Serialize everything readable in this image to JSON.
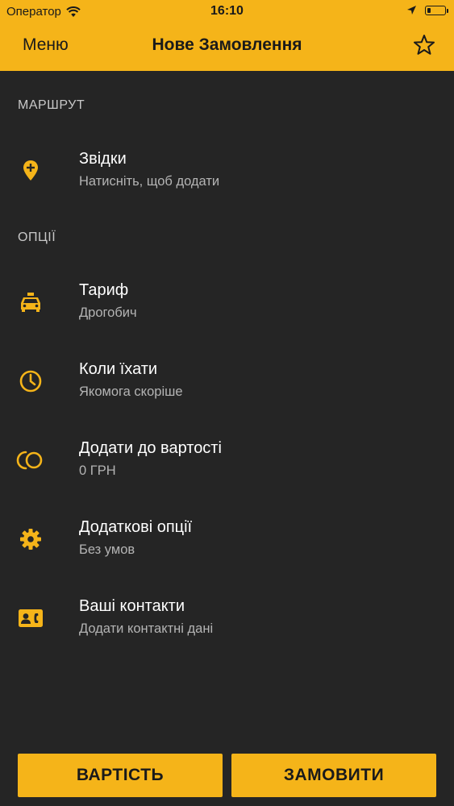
{
  "status_bar": {
    "carrier": "Оператор",
    "time": "16:10",
    "icons": [
      "wifi-icon",
      "location-arrow-icon",
      "battery-icon"
    ]
  },
  "navbar": {
    "menu_label": "Меню",
    "title": "Нове Замовлення",
    "favorite_icon": "star-outline-icon"
  },
  "route": {
    "header": "МАРШРУТ",
    "items": [
      {
        "icon": "map-pin-plus-icon",
        "title": "Звідки",
        "subtitle": "Натисніть, щоб додати"
      }
    ]
  },
  "options": {
    "header": "ОПЦІЇ",
    "items": [
      {
        "icon": "taxi-car-icon",
        "title": "Тариф",
        "subtitle": "Дрогобич"
      },
      {
        "icon": "clock-icon",
        "title": "Коли їхати",
        "subtitle": "Якомога скоріше"
      },
      {
        "icon": "coins-icon",
        "title": "Додати до вартості",
        "subtitle": "0 ГРН"
      },
      {
        "icon": "gear-icon",
        "title": "Додаткові опції",
        "subtitle": "Без умов"
      },
      {
        "icon": "contact-card-icon",
        "title": "Ваші контакти",
        "subtitle": "Додати контактні дані"
      }
    ]
  },
  "actions": {
    "price_label": "ВАРТІСТЬ",
    "order_label": "ЗАМОВИТИ"
  },
  "colors": {
    "accent": "#f5b419",
    "background": "#252525",
    "primary_text": "#ffffff",
    "secondary_text": "#b4b4b4"
  }
}
